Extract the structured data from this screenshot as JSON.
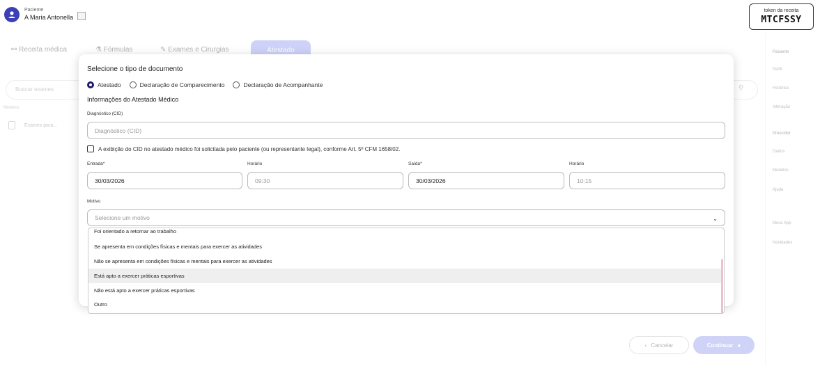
{
  "header": {
    "patient_label": "Paciente",
    "patient_name": "A Maria Antonella",
    "token_label": "token da receita",
    "token_value": "MTCFSSY"
  },
  "background": {
    "tabs": [
      "Receita médica",
      "Fórmulas",
      "Exames e Cirurgias",
      "Atestado"
    ],
    "search_placeholder": "Buscar exames",
    "modelos_label": "Modelos",
    "exames_item": "Exames para...",
    "sidebar": {
      "section1": "Paciente",
      "items1": [
        "Perfil",
        "Histórico",
        "Interação"
      ],
      "section2": "Prescritor",
      "items2": [
        "Dados",
        "Modelos",
        "Ajuda"
      ],
      "items3": [
        "Meus App",
        "Novidades"
      ]
    },
    "cancel_label": "Cancelar",
    "continue_label": "Continuar"
  },
  "modal": {
    "title": "Selecione o tipo de documento",
    "doc_types": [
      {
        "label": "Atestado",
        "selected": true
      },
      {
        "label": "Declaração de Comparecimento",
        "selected": false
      },
      {
        "label": "Declaração de Acompanhante",
        "selected": false
      }
    ],
    "section_title": "Informações do Atestado Médico",
    "cid_label": "Diagnóstico (CID)",
    "cid_placeholder": "Diagnóstico (CID)",
    "cid_checkbox_label": "A exibição do CID no atestado médico foi solicitada pelo paciente (ou representante legal), conforme Art. 5º CFM 1658/02.",
    "entrada_label": "Entrada*",
    "entrada_value": "30/03/2026",
    "horario1_label": "Horário",
    "horario1_value": "09:30",
    "saida_label": "Saída*",
    "saida_value": "30/03/2026",
    "horario2_label": "Horário",
    "horario2_value": "10:15",
    "motivo_label": "Motivo",
    "motivo_placeholder": "Selecione um motivo",
    "motivo_options": [
      "Foi orientado a retornar ao trabalho",
      "Se apresenta em condições físicas e mentais para exercer as atividades",
      "Não se apresenta em condições físicas e mentais para exercer as atividades",
      "Está apto a exercer práticas esportivas",
      "Não está apto a exercer práticas esportivas",
      "Outro"
    ]
  }
}
